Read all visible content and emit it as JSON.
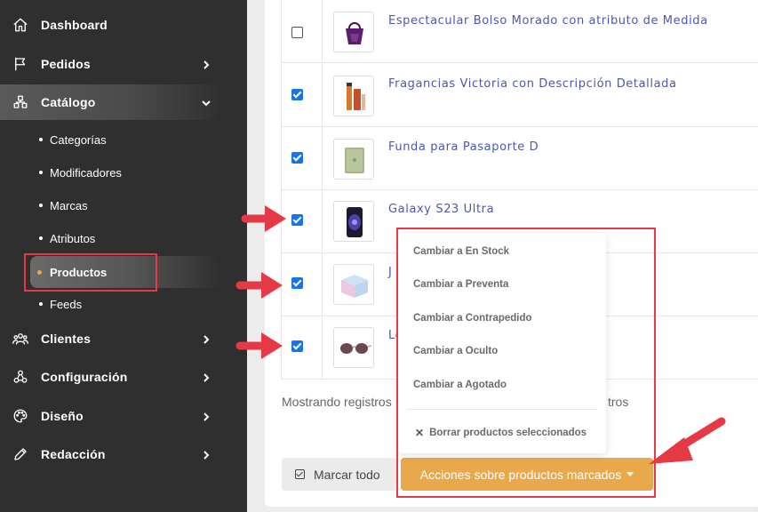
{
  "sidebar": {
    "items": [
      {
        "label": "Dashboard",
        "icon": "home-icon"
      },
      {
        "label": "Pedidos",
        "icon": "flag-icon"
      },
      {
        "label": "Catálogo",
        "icon": "catalog-icon"
      },
      {
        "label": "Clientes",
        "icon": "users-icon"
      },
      {
        "label": "Configuración",
        "icon": "config-icon"
      },
      {
        "label": "Diseño",
        "icon": "palette-icon"
      },
      {
        "label": "Redacción",
        "icon": "pen-icon"
      }
    ],
    "catalog_sub": [
      "Categorías",
      "Modificadores",
      "Marcas",
      "Atributos",
      "Productos",
      "Feeds"
    ]
  },
  "products": [
    {
      "name": "Espectacular Bolso Morado con atributo de Medida",
      "checked": false
    },
    {
      "name": "Fragancias Victoria con Descripción Detallada",
      "checked": true
    },
    {
      "name": "Funda para Pasaporte D",
      "checked": true
    },
    {
      "name": "Galaxy S23 Ultra",
      "checked": true
    },
    {
      "name": "J",
      "checked": true
    },
    {
      "name": "Le",
      "checked": true
    }
  ],
  "footer": {
    "showing_text": "Mostrando registros",
    "showing_tail": "tros"
  },
  "buttons": {
    "mark_all": "Marcar todo",
    "bulk_actions": "Acciones sobre productos marcados"
  },
  "dropdown": {
    "items": [
      "Cambiar a En Stock",
      "Cambiar a Preventa",
      "Cambiar a Contrapedido",
      "Cambiar a Oculto",
      "Cambiar a Agotado"
    ],
    "delete": "Borrar productos seleccionados"
  },
  "colors": {
    "accent": "#e8a94c",
    "highlight": "#e63946",
    "link": "#4a58b0"
  }
}
